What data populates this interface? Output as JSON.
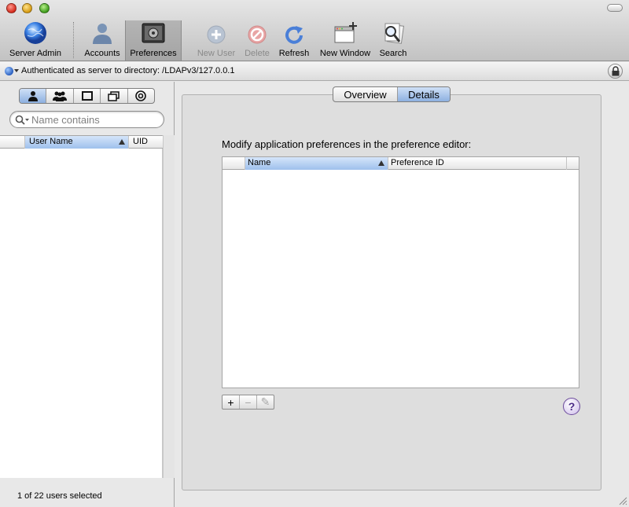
{
  "window": {
    "toolbar": {
      "items": [
        {
          "label": "Server Admin",
          "icon": "globe-icon"
        },
        {
          "label": "Accounts",
          "icon": "person-icon"
        },
        {
          "label": "Preferences",
          "icon": "preferences-panel-icon"
        },
        {
          "label": "New User",
          "icon": "plus-circle-icon",
          "disabled": true
        },
        {
          "label": "Delete",
          "icon": "no-entry-icon",
          "disabled": true
        },
        {
          "label": "Refresh",
          "icon": "refresh-icon"
        },
        {
          "label": "New Window",
          "icon": "new-window-icon"
        },
        {
          "label": "Search",
          "icon": "magnifier-icon"
        }
      ]
    }
  },
  "directory": {
    "text": "Authenticated as server to directory: /LDAPv3/127.0.0.1"
  },
  "left": {
    "segments": [
      "users-icon",
      "groups-icon",
      "computers-icon",
      "computer-groups-icon",
      "target-icon"
    ],
    "search": {
      "placeholder": "Name contains",
      "value": ""
    },
    "columns": [
      "User Name",
      "UID"
    ],
    "rows": [],
    "status": "1 of 22 users selected"
  },
  "right": {
    "tabs": [
      "Overview",
      "Details"
    ],
    "selected_tab": "Details",
    "caption": "Modify application preferences in the preference editor:",
    "columns": [
      "Name",
      "Preference ID"
    ],
    "rows": [],
    "buttons": {
      "add": "+",
      "remove": "−",
      "edit": "✎"
    },
    "help": "?"
  },
  "colors": {
    "selection": "#9ec0ec",
    "help_accent": "#4a2a86"
  }
}
